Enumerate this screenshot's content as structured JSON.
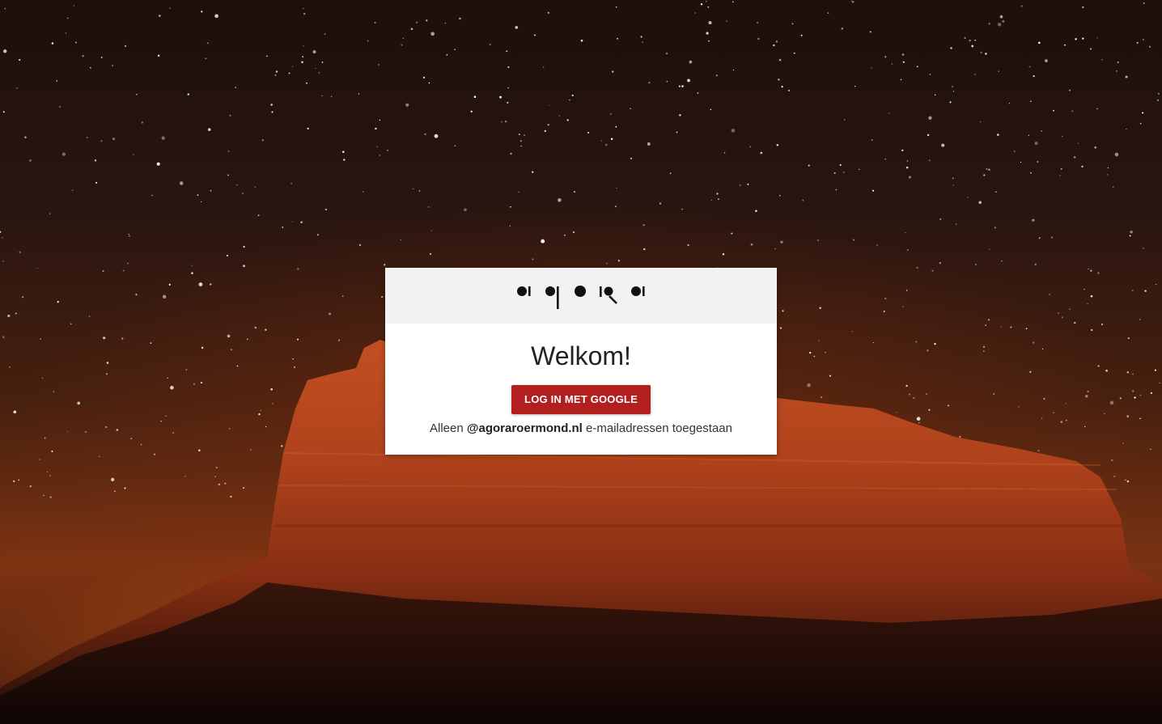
{
  "brand": {
    "logo_text": "agora",
    "accent_color": "#b21f1f"
  },
  "login": {
    "title": "Welkom!",
    "button_label": "LOG IN MET GOOGLE",
    "note_prefix": "Alleen",
    "note_domain": "@agoraroermond.nl",
    "note_suffix": "e-mailadressen toegestaan"
  }
}
